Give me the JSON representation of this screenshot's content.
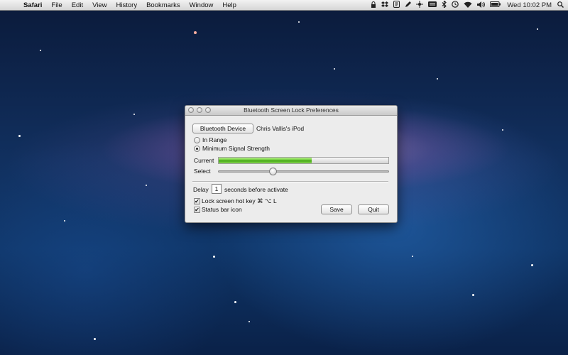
{
  "menubar": {
    "apple": "",
    "app_name": "Safari",
    "menus": [
      "File",
      "Edit",
      "View",
      "History",
      "Bookmarks",
      "Window",
      "Help"
    ],
    "status_icons": [
      "lock-icon",
      "dropbox-icon",
      "shield-icon",
      "pen-icon",
      "crosshair-icon",
      "keyboard-icon",
      "bluetooth-icon",
      "time-machine-icon",
      "wifi-icon",
      "volume-icon",
      "battery-icon"
    ],
    "clock": "Wed 10:02 PM",
    "spotlight": "🔍"
  },
  "window": {
    "title": "Bluetooth Screen Lock Preferences",
    "bluetooth_device_button": "Bluetooth Device",
    "device_name": "Chris Vallis's iPod",
    "radio_in_range": "In Range",
    "radio_min_signal": "Minimum Signal Strength",
    "selected_mode": "Minimum Signal Strength",
    "current_label": "Current",
    "current_level": 0.55,
    "select_label": "Select",
    "select_level": 0.32,
    "delay_label": "Delay",
    "delay_value": "1",
    "delay_suffix": "seconds before activate",
    "lock_hotkey_label": "Lock screen hot key ⌘ ⌥ L",
    "lock_hotkey_checked": true,
    "status_bar_label": "Status bar icon",
    "status_bar_checked": true,
    "save_label": "Save",
    "quit_label": "Quit"
  }
}
